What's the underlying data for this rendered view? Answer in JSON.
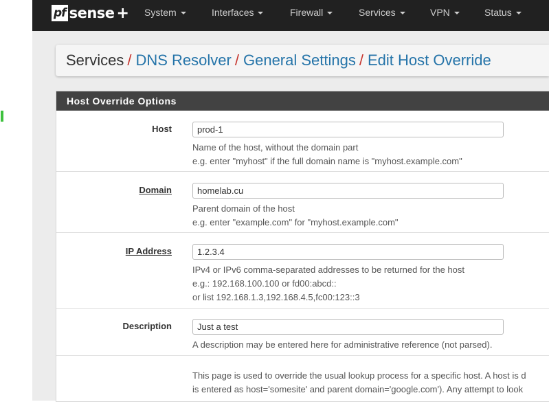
{
  "navbar": {
    "brand": {
      "pf": "pf",
      "sense": "sense",
      "plus": "+"
    },
    "menu": [
      {
        "label": "System"
      },
      {
        "label": "Interfaces"
      },
      {
        "label": "Firewall"
      },
      {
        "label": "Services"
      },
      {
        "label": "VPN"
      },
      {
        "label": "Status"
      }
    ]
  },
  "breadcrumb": {
    "root": "Services",
    "separator": "/",
    "links": [
      "DNS Resolver",
      "General Settings",
      "Edit Host Override"
    ]
  },
  "panel": {
    "title": "Host Override Options",
    "fields": {
      "host": {
        "label": "Host",
        "value": "prod-1",
        "help": [
          "Name of the host, without the domain part",
          "e.g. enter \"myhost\" if the full domain name is \"myhost.example.com\""
        ]
      },
      "domain": {
        "label": "Domain",
        "value": "homelab.cu",
        "help": [
          "Parent domain of the host",
          "e.g. enter \"example.com\" for \"myhost.example.com\""
        ]
      },
      "ip": {
        "label": "IP Address",
        "value": "1.2.3.4",
        "help": [
          "IPv4 or IPv6 comma-separated addresses to be returned for the host",
          "e.g.: 192.168.100.100 or fd00:abcd::",
          "or list 192.168.1.3,192.168.4.5,fc00:123::3"
        ]
      },
      "description": {
        "label": "Description",
        "value": "Just a test",
        "help": [
          "A description may be entered here for administrative reference (not parsed)."
        ]
      }
    },
    "info": [
      "This page is used to override the usual lookup process for a specific host. A host is d",
      "is entered as host='somesite' and parent domain='google.com'). Any attempt to look"
    ]
  },
  "colors": {
    "navbar_bg": "#212121",
    "panel_heading_bg": "#424242",
    "link": "#2574a9",
    "separator": "#c7362f",
    "indicator": "#3ec13e"
  }
}
